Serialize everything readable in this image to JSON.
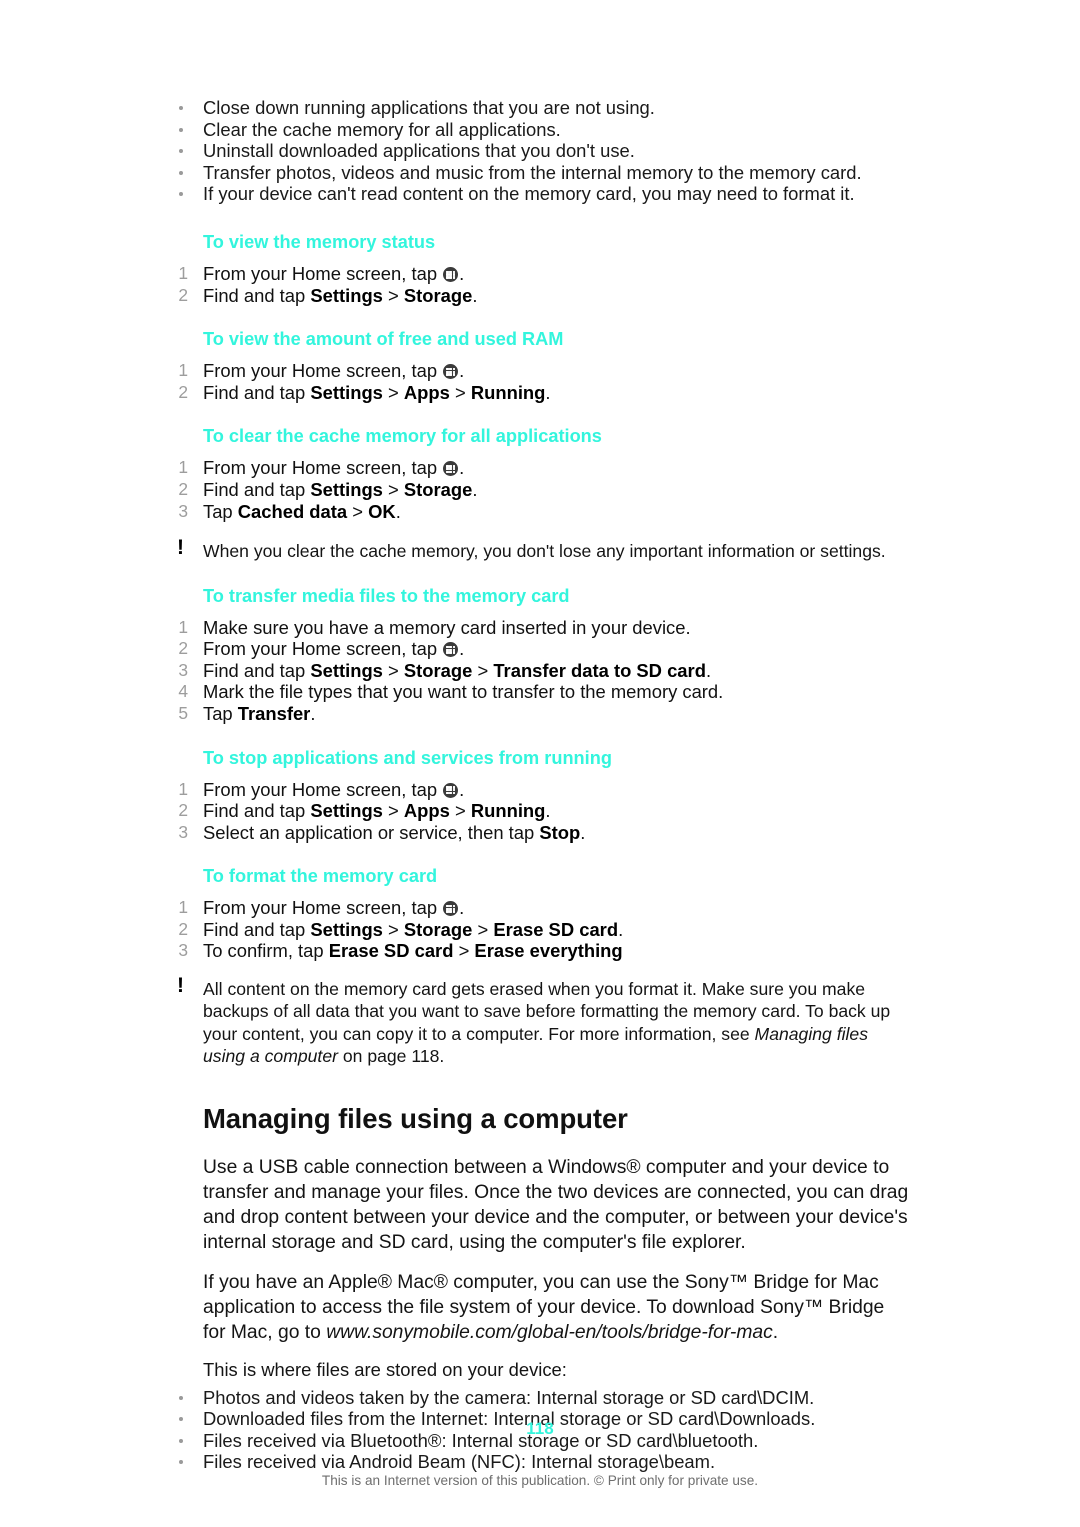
{
  "document": {
    "page_number": "118",
    "copyright": "This is an Internet version of this publication. © Print only for private use.",
    "heading_color": "#33F5DD",
    "text_color": "#111111",
    "marker_color": "#9D9D9D"
  },
  "tips_list": {
    "items": [
      "Close down running applications that you are not using.",
      "Clear the cache memory for all applications.",
      "Uninstall downloaded applications that you don't use.",
      "Transfer photos, videos and music from the internal memory to the memory card.",
      "If your device can't read content on the memory card, you may need to format it."
    ]
  },
  "procedures": [
    {
      "title": "To view the memory status",
      "steps": [
        {
          "num": "1",
          "pre": "From your Home screen, tap ",
          "icon": "app-drawer-icon",
          "post": "."
        },
        {
          "num": "2",
          "pre": "Find and tap ",
          "bold1": "Settings",
          "sep1": " > ",
          "bold2": "Storage",
          "post": "."
        }
      ]
    },
    {
      "title": "To view the amount of free and used RAM",
      "steps": [
        {
          "num": "1",
          "pre": "From your Home screen, tap ",
          "icon": "app-drawer-icon",
          "post": "."
        },
        {
          "num": "2",
          "pre": "Find and tap ",
          "bold1": "Settings",
          "sep1": " > ",
          "bold2": "Apps",
          "sep2": " > ",
          "bold3": "Running",
          "post": "."
        }
      ]
    },
    {
      "title": "To clear the cache memory for all applications",
      "steps": [
        {
          "num": "1",
          "pre": "From your Home screen, tap ",
          "icon": "app-drawer-icon",
          "post": "."
        },
        {
          "num": "2",
          "pre": "Find and tap ",
          "bold1": "Settings",
          "sep1": " > ",
          "bold2": "Storage",
          "post": "."
        },
        {
          "num": "3",
          "pre": "Tap ",
          "bold1": "Cached data",
          "sep1": " > ",
          "bold2": "OK",
          "post": "."
        }
      ],
      "note": "When you clear the cache memory, you don't lose any important information or settings."
    },
    {
      "title": "To transfer media files to the memory card",
      "steps": [
        {
          "num": "1",
          "pre": "Make sure you have a memory card inserted in your device."
        },
        {
          "num": "2",
          "pre": "From your Home screen, tap ",
          "icon": "app-drawer-icon",
          "post": "."
        },
        {
          "num": "3",
          "pre": "Find and tap ",
          "bold1": "Settings",
          "sep1": " > ",
          "bold2": "Storage",
          "sep2": " > ",
          "bold3": "Transfer data to SD card",
          "post": "."
        },
        {
          "num": "4",
          "pre": "Mark the file types that you want to transfer to the memory card."
        },
        {
          "num": "5",
          "pre": "Tap ",
          "bold1": "Transfer",
          "post": "."
        }
      ]
    },
    {
      "title": "To stop applications and services from running",
      "steps": [
        {
          "num": "1",
          "pre": "From your Home screen, tap ",
          "icon": "app-drawer-icon",
          "post": "."
        },
        {
          "num": "2",
          "pre": "Find and tap ",
          "bold1": "Settings",
          "sep1": " > ",
          "bold2": "Apps",
          "sep2": " > ",
          "bold3": "Running",
          "post": "."
        },
        {
          "num": "3",
          "pre": "Select an application or service, then tap ",
          "bold1": "Stop",
          "post": "."
        }
      ]
    },
    {
      "title": "To format the memory card",
      "steps": [
        {
          "num": "1",
          "pre": "From your Home screen, tap ",
          "icon": "app-drawer-icon",
          "post": "."
        },
        {
          "num": "2",
          "pre": "Find and tap ",
          "bold1": "Settings",
          "sep1": " > ",
          "bold2": "Storage",
          "sep2": " > ",
          "bold3": "Erase SD card",
          "post": "."
        },
        {
          "num": "3",
          "pre": "To confirm, tap ",
          "bold1": "Erase SD card",
          "sep1": " > ",
          "bold2": "Erase everything",
          "post": ""
        }
      ]
    }
  ],
  "format_warning": {
    "part1": "All content on the memory card gets erased when you format it. Make sure you make backups of all data that you want to save before formatting the memory card. To back up your content, you can copy it to a computer. For more information, see ",
    "italic": "Managing files using a computer",
    "part2": " on page 118."
  },
  "section": {
    "heading": "Managing files using a computer",
    "paragraph1": "Use a USB cable connection between a Windows® computer and your device to transfer and manage your files. Once the two devices are connected, you can drag and drop content between your device and the computer, or between your device's internal storage and SD card, using the computer's file explorer.",
    "paragraph2_pre": "If you have an Apple® Mac® computer, you can use the Sony™ Bridge for Mac application to access the file system of your device. To download Sony™ Bridge for Mac, go to ",
    "paragraph2_url": "www.sonymobile.com/global-en/tools/bridge-for-mac",
    "paragraph2_post": ".",
    "storage_lead": "This is where files are stored on your device:",
    "storage_items": [
      "Photos and videos taken by the camera: Internal storage or SD card\\DCIM.",
      "Downloaded files from the Internet: Internal storage or SD card\\Downloads.",
      "Files received via Bluetooth®: Internal storage or SD card\\bluetooth.",
      "Files received via Android Beam (NFC): Internal storage\\beam."
    ]
  }
}
